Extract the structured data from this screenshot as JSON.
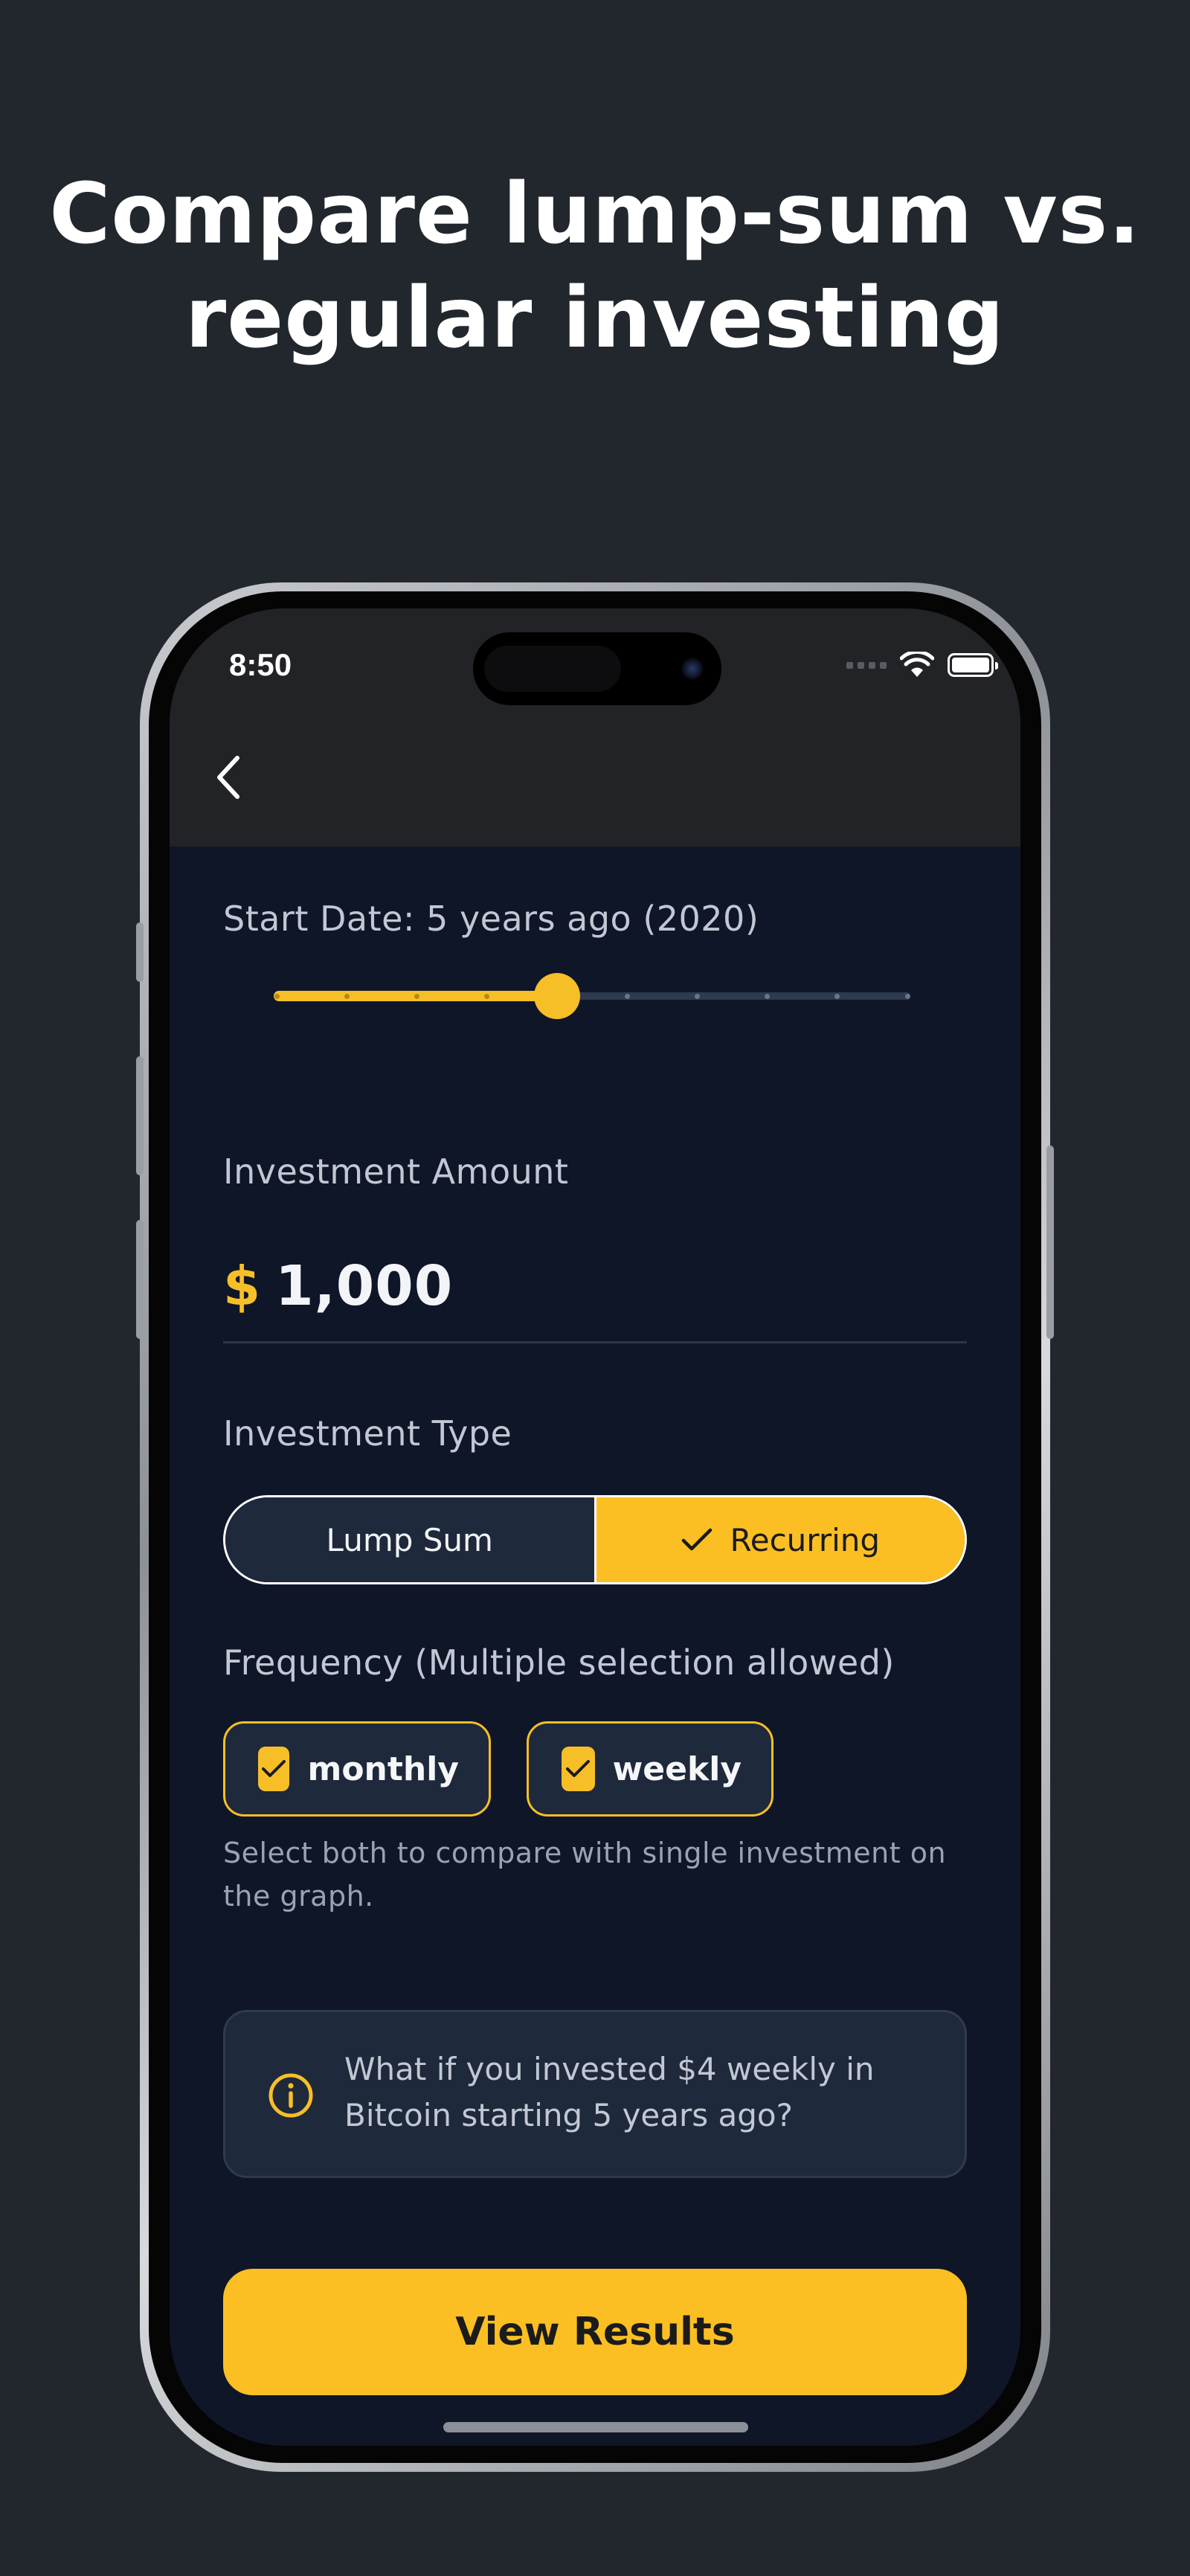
{
  "headline": {
    "line1": "Compare lump-sum vs.",
    "line2": "regular investing"
  },
  "status_bar": {
    "time": "8:50",
    "icons": [
      "signal-icon",
      "wifi-icon",
      "battery-icon"
    ]
  },
  "nav": {
    "back_icon": "chevron-left-icon"
  },
  "start_date": {
    "label": "Start Date: 5 years ago (2020)",
    "slider_steps": 10,
    "slider_selected_index": 4
  },
  "investment_amount": {
    "label": "Investment Amount",
    "currency_symbol": "$",
    "value": "1,000"
  },
  "investment_type": {
    "label": "Investment Type",
    "options": [
      {
        "label": "Lump Sum",
        "selected": false
      },
      {
        "label": "Recurring",
        "selected": true
      }
    ]
  },
  "frequency": {
    "label": "Frequency (Multiple selection allowed)",
    "options": [
      {
        "label": "monthly",
        "checked": true
      },
      {
        "label": "weekly",
        "checked": true
      }
    ],
    "hint_line1": "Select both to compare with single investment on",
    "hint_line2": "the graph."
  },
  "info": {
    "icon": "info-icon",
    "line1": "What if you invested $4 weekly in",
    "line2": "Bitcoin starting 5 years ago?"
  },
  "cta": {
    "label": "View Results"
  },
  "colors": {
    "background": "#22262d",
    "screen": "#0f1628",
    "accent": "#fbbf24",
    "card": "#1e293b"
  }
}
